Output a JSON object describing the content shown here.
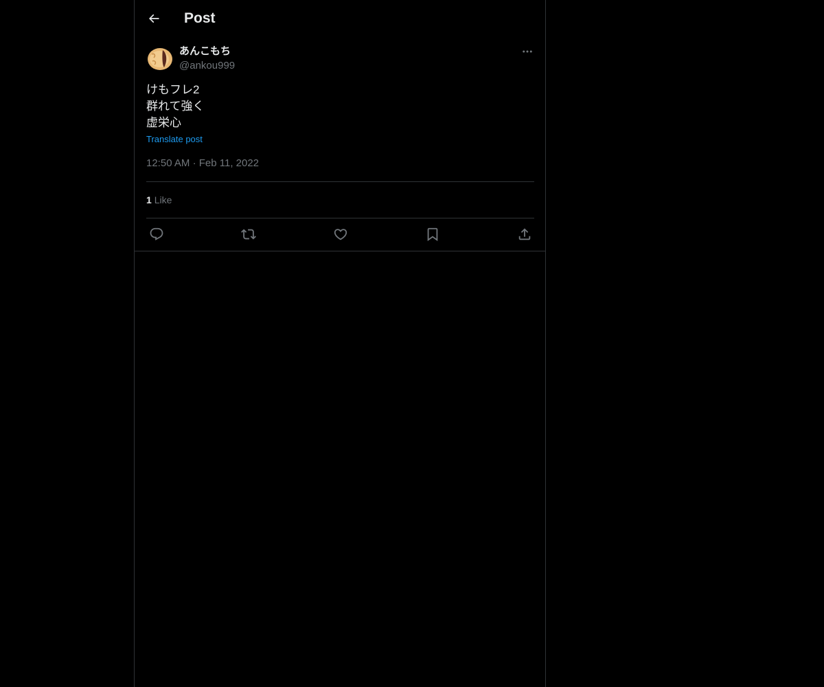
{
  "header": {
    "title": "Post",
    "back_icon": "arrow-left-icon"
  },
  "author": {
    "display_name": "あんこもち",
    "handle": "@ankou999",
    "avatar_icon": "taiyaki-avatar"
  },
  "post": {
    "lines": [
      "けもフレ2",
      "群れて強く",
      "虚栄心"
    ],
    "translate_label": "Translate post",
    "time": "12:50 AM",
    "separator": "·",
    "date": "Feb 11, 2022"
  },
  "stats": {
    "like_count": "1",
    "like_label": "Like"
  },
  "actions": [
    {
      "name": "reply-icon"
    },
    {
      "name": "repost-icon"
    },
    {
      "name": "like-icon"
    },
    {
      "name": "bookmark-icon"
    },
    {
      "name": "share-icon"
    }
  ],
  "colors": {
    "background": "#000000",
    "text_primary": "#e7e9ea",
    "text_secondary": "#71767b",
    "link": "#1d9bf0",
    "border": "#2f3336"
  }
}
